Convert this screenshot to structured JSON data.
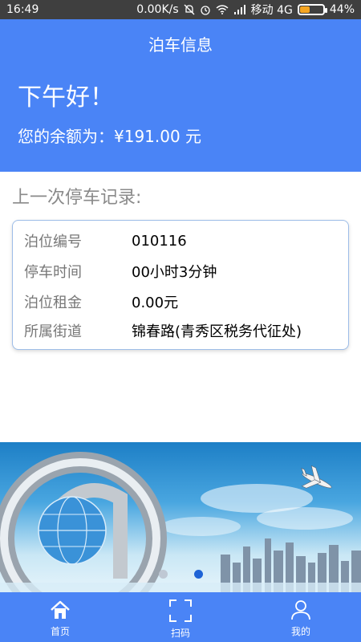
{
  "status_bar": {
    "time": "16:49",
    "net_speed": "0.00K/s",
    "carrier": "移动 4G",
    "battery_percent": "44%",
    "battery_level": 0.44
  },
  "header": {
    "title": "泊车信息",
    "greeting": "下午好！",
    "balance_text": "您的余额为：¥191.00 元"
  },
  "last_record": {
    "section_title": "上一次停车记录:",
    "fields": [
      {
        "label": "泊位编号",
        "value": "010116"
      },
      {
        "label": "停车时间",
        "value": "00小时3分钟"
      },
      {
        "label": "泊位租金",
        "value": "0.00元"
      },
      {
        "label": "所属街道",
        "value": "锦春路(青秀区税务代征处)"
      }
    ]
  },
  "carousel": {
    "active_index": 1,
    "colors": {
      "active": "#1e63d6",
      "inactive": "#bfc8d4"
    }
  },
  "tabbar": {
    "tabs": [
      {
        "label": "首页",
        "icon": "home-icon"
      },
      {
        "label": "扫码",
        "icon": "scan-icon"
      },
      {
        "label": "我的",
        "icon": "user-icon"
      }
    ]
  },
  "colors": {
    "primary": "#4a84f6",
    "card_border": "#9dbde8",
    "muted_text": "#8a8a8a"
  }
}
